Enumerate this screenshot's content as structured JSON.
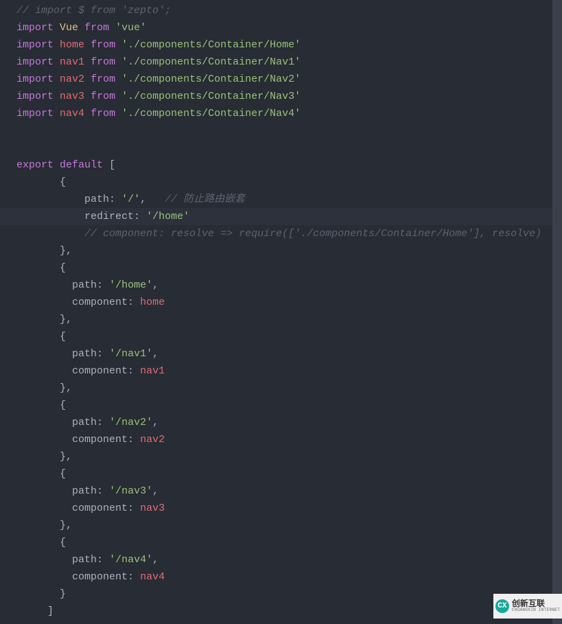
{
  "lines": [
    {
      "type": "comment",
      "text": "// import $ from 'zepto';"
    },
    {
      "type": "import",
      "ident": "Vue",
      "identColor": "yellow",
      "from": "'vue'"
    },
    {
      "type": "import",
      "ident": "home",
      "identColor": "red",
      "from": "'./components/Container/Home'"
    },
    {
      "type": "import",
      "ident": "nav1",
      "identColor": "red",
      "from": "'./components/Container/Nav1'"
    },
    {
      "type": "import",
      "ident": "nav2",
      "identColor": "red",
      "from": "'./components/Container/Nav2'"
    },
    {
      "type": "import",
      "ident": "nav3",
      "identColor": "red",
      "from": "'./components/Container/Nav3'"
    },
    {
      "type": "import",
      "ident": "nav4",
      "identColor": "red",
      "from": "'./components/Container/Nav4'"
    },
    {
      "type": "blank"
    },
    {
      "type": "blank"
    },
    {
      "type": "export-open",
      "text": "export default ["
    },
    {
      "type": "plain",
      "indent": 7,
      "text": "{"
    },
    {
      "type": "prop-str-comment",
      "indent": 11,
      "key": "path",
      "val": "'/'",
      "comma": ",",
      "comment": "   // 防止路由嵌套"
    },
    {
      "type": "prop-str",
      "indent": 11,
      "key": "redirect",
      "val": "'/home'",
      "comma": "",
      "highlighted": true
    },
    {
      "type": "comment-indent",
      "indent": 11,
      "text": "// component: resolve => require(['./components/Container/Home'], resolve)"
    },
    {
      "type": "plain",
      "indent": 7,
      "text": "},"
    },
    {
      "type": "plain",
      "indent": 7,
      "text": "{"
    },
    {
      "type": "prop-str",
      "indent": 9,
      "key": "path",
      "val": "'/home'",
      "comma": ","
    },
    {
      "type": "prop-ident",
      "indent": 9,
      "key": "component",
      "val": "home",
      "comma": ""
    },
    {
      "type": "plain",
      "indent": 7,
      "text": "},"
    },
    {
      "type": "plain",
      "indent": 7,
      "text": "{"
    },
    {
      "type": "prop-str",
      "indent": 9,
      "key": "path",
      "val": "'/nav1'",
      "comma": ","
    },
    {
      "type": "prop-ident",
      "indent": 9,
      "key": "component",
      "val": "nav1",
      "comma": ""
    },
    {
      "type": "plain",
      "indent": 7,
      "text": "},"
    },
    {
      "type": "plain",
      "indent": 7,
      "text": "{"
    },
    {
      "type": "prop-str",
      "indent": 9,
      "key": "path",
      "val": "'/nav2'",
      "comma": ","
    },
    {
      "type": "prop-ident",
      "indent": 9,
      "key": "component",
      "val": "nav2",
      "comma": ""
    },
    {
      "type": "plain",
      "indent": 7,
      "text": "},"
    },
    {
      "type": "plain",
      "indent": 7,
      "text": "{"
    },
    {
      "type": "prop-str",
      "indent": 9,
      "key": "path",
      "val": "'/nav3'",
      "comma": ","
    },
    {
      "type": "prop-ident",
      "indent": 9,
      "key": "component",
      "val": "nav3",
      "comma": ""
    },
    {
      "type": "plain",
      "indent": 7,
      "text": "},"
    },
    {
      "type": "plain",
      "indent": 7,
      "text": "{"
    },
    {
      "type": "prop-str",
      "indent": 9,
      "key": "path",
      "val": "'/nav4'",
      "comma": ","
    },
    {
      "type": "prop-ident",
      "indent": 9,
      "key": "component",
      "val": "nav4",
      "comma": ""
    },
    {
      "type": "plain",
      "indent": 7,
      "text": "}"
    },
    {
      "type": "plain",
      "indent": 5,
      "text": "]"
    }
  ],
  "watermark": {
    "logo": "CX",
    "cn": "创新互联",
    "en": "CHUANGXIN INTERNET"
  }
}
